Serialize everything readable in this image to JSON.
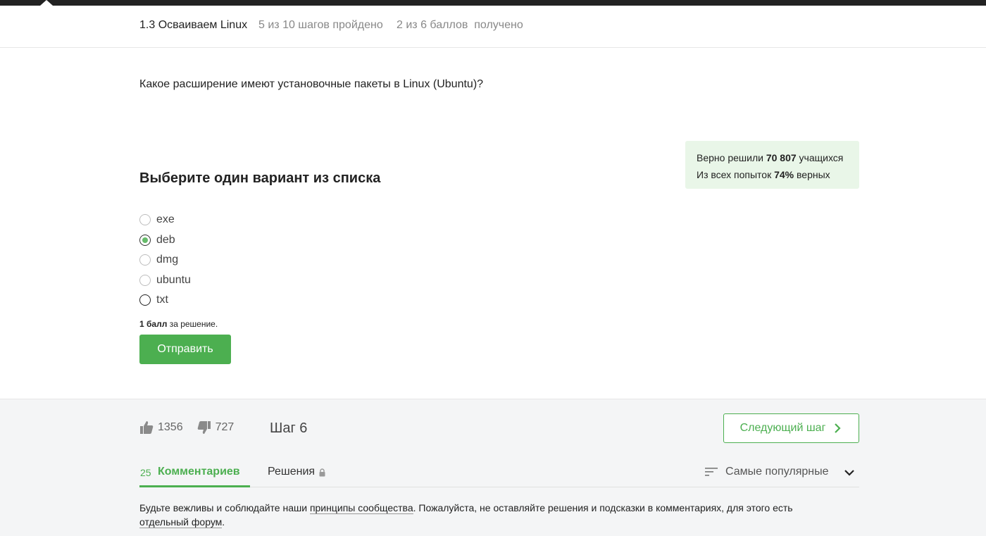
{
  "header": {
    "lesson_title": "1.3 Осваиваем Linux",
    "progress": "5 из 10 шагов пройдено",
    "score": "2 из 6 баллов  получено"
  },
  "question": "Какое расширение имеют установочные пакеты в Linux (Ubuntu)?",
  "stats": {
    "solved_prefix": "Верно решили",
    "solved_count": "70 807",
    "solved_suffix": "учащихся",
    "attempts_prefix": "Из всех попыток",
    "attempts_percent": "74%",
    "attempts_suffix": "верных"
  },
  "choose_title": "Выберите один вариант из списка",
  "options": [
    {
      "label": "exe",
      "checked": false
    },
    {
      "label": "deb",
      "checked": true
    },
    {
      "label": "dmg",
      "checked": false
    },
    {
      "label": "ubuntu",
      "checked": false
    },
    {
      "label": "txt",
      "checked": false
    }
  ],
  "points": {
    "bold": "1 балл",
    "rest": "за решение."
  },
  "submit_label": "Отправить",
  "footer": {
    "likes": "1356",
    "dislikes": "727",
    "step_label": "Шаг 6",
    "next_label": "Следующий шаг",
    "tabs": {
      "comments_count": "25",
      "comments_label": "Комментариев",
      "solutions_label": "Решения"
    },
    "sort_label": "Самые популярные",
    "notice": {
      "part1": "Будьте вежливы и соблюдайте наши ",
      "link1": "принципы сообщества",
      "part2": ". Пожалуйста, не оставляйте решения и подсказки в комментариях, для этого есть ",
      "link2": "отдельный форум",
      "part3": "."
    }
  },
  "colors": {
    "accent": "#4caf50",
    "stats_bg": "#e9f6e8",
    "footer_bg": "#f4f5f6",
    "topbar": "#222222"
  },
  "icons": [
    "thumbs-up-icon",
    "thumbs-down-icon",
    "chevron-right-icon",
    "lock-icon",
    "sort-icon",
    "chevron-down-icon"
  ]
}
